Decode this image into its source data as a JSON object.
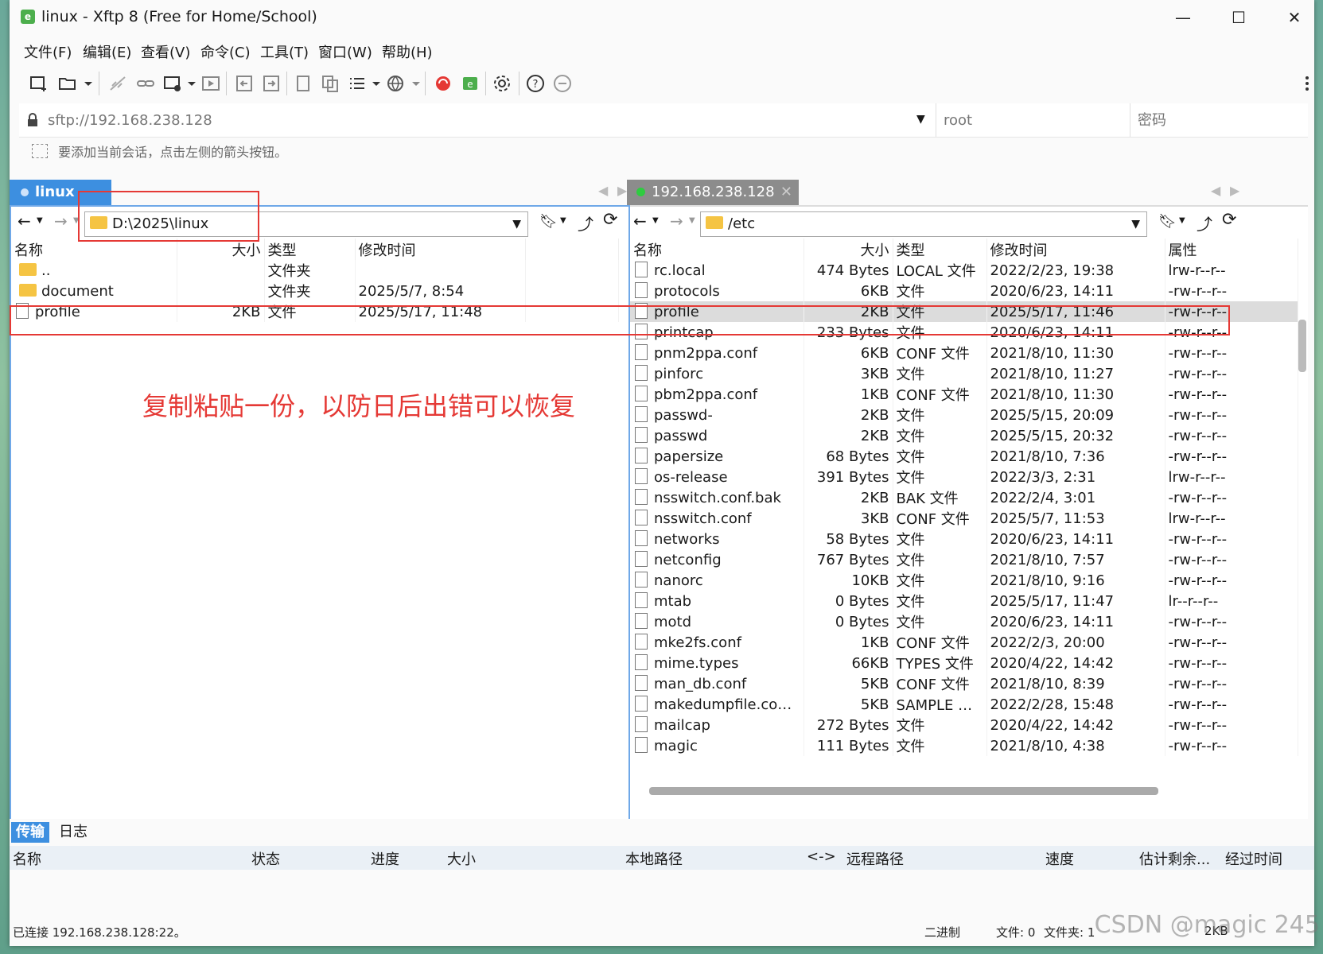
{
  "window": {
    "title": "linux - Xftp 8 (Free for Home/School)"
  },
  "menu": [
    "文件(F)",
    "编辑(E)",
    "查看(V)",
    "命令(C)",
    "工具(T)",
    "窗口(W)",
    "帮助(H)"
  ],
  "address": {
    "url": "sftp://192.168.238.128",
    "user": "root",
    "password_placeholder": "密码"
  },
  "hint": "要添加当前会话，点击左侧的箭头按钮。",
  "left_pane": {
    "tab": "linux",
    "path": "D:\\2025\\linux",
    "columns": [
      "名称",
      "大小",
      "类型",
      "修改时间"
    ],
    "rows": [
      {
        "name": "..",
        "size": "",
        "type": "文件夹",
        "modified": "",
        "kind": "folder"
      },
      {
        "name": "document",
        "size": "",
        "type": "文件夹",
        "modified": "2025/5/7, 8:54",
        "kind": "folder"
      },
      {
        "name": "profile",
        "size": "2KB",
        "type": "文件",
        "modified": "2025/5/17, 11:48",
        "kind": "file"
      }
    ]
  },
  "right_pane": {
    "tab": "192.168.238.128",
    "path": "/etc",
    "columns": [
      "名称",
      "大小",
      "类型",
      "修改时间",
      "属性"
    ],
    "rows": [
      {
        "name": "rc.local",
        "size": "474 Bytes",
        "type": "LOCAL 文件",
        "modified": "2022/2/23, 19:38",
        "attr": "lrw-r--r--"
      },
      {
        "name": "protocols",
        "size": "6KB",
        "type": "文件",
        "modified": "2020/6/23, 14:11",
        "attr": "-rw-r--r--"
      },
      {
        "name": "profile",
        "size": "2KB",
        "type": "文件",
        "modified": "2025/5/17, 11:46",
        "attr": "-rw-r--r--"
      },
      {
        "name": "printcap",
        "size": "233 Bytes",
        "type": "文件",
        "modified": "2020/6/23, 14:11",
        "attr": "-rw-r--r--"
      },
      {
        "name": "pnm2ppa.conf",
        "size": "6KB",
        "type": "CONF 文件",
        "modified": "2021/8/10, 11:30",
        "attr": "-rw-r--r--"
      },
      {
        "name": "pinforc",
        "size": "3KB",
        "type": "文件",
        "modified": "2021/8/10, 11:27",
        "attr": "-rw-r--r--"
      },
      {
        "name": "pbm2ppa.conf",
        "size": "1KB",
        "type": "CONF 文件",
        "modified": "2021/8/10, 11:30",
        "attr": "-rw-r--r--"
      },
      {
        "name": "passwd-",
        "size": "2KB",
        "type": "文件",
        "modified": "2025/5/15, 20:09",
        "attr": "-rw-r--r--"
      },
      {
        "name": "passwd",
        "size": "2KB",
        "type": "文件",
        "modified": "2025/5/15, 20:32",
        "attr": "-rw-r--r--"
      },
      {
        "name": "papersize",
        "size": "68 Bytes",
        "type": "文件",
        "modified": "2021/8/10, 7:36",
        "attr": "-rw-r--r--"
      },
      {
        "name": "os-release",
        "size": "391 Bytes",
        "type": "文件",
        "modified": "2022/3/3, 2:31",
        "attr": "lrw-r--r--"
      },
      {
        "name": "nsswitch.conf.bak",
        "size": "2KB",
        "type": "BAK 文件",
        "modified": "2022/2/4, 3:01",
        "attr": "-rw-r--r--"
      },
      {
        "name": "nsswitch.conf",
        "size": "3KB",
        "type": "CONF 文件",
        "modified": "2025/5/7, 11:53",
        "attr": "lrw-r--r--"
      },
      {
        "name": "networks",
        "size": "58 Bytes",
        "type": "文件",
        "modified": "2020/6/23, 14:11",
        "attr": "-rw-r--r--"
      },
      {
        "name": "netconfig",
        "size": "767 Bytes",
        "type": "文件",
        "modified": "2021/8/10, 7:57",
        "attr": "-rw-r--r--"
      },
      {
        "name": "nanorc",
        "size": "10KB",
        "type": "文件",
        "modified": "2021/8/10, 9:16",
        "attr": "-rw-r--r--"
      },
      {
        "name": "mtab",
        "size": "0 Bytes",
        "type": "文件",
        "modified": "2025/5/17, 11:47",
        "attr": "lr--r--r--"
      },
      {
        "name": "motd",
        "size": "0 Bytes",
        "type": "文件",
        "modified": "2020/6/23, 14:11",
        "attr": "-rw-r--r--"
      },
      {
        "name": "mke2fs.conf",
        "size": "1KB",
        "type": "CONF 文件",
        "modified": "2022/2/3, 20:00",
        "attr": "-rw-r--r--"
      },
      {
        "name": "mime.types",
        "size": "66KB",
        "type": "TYPES 文件",
        "modified": "2020/4/22, 14:42",
        "attr": "-rw-r--r--"
      },
      {
        "name": "man_db.conf",
        "size": "5KB",
        "type": "CONF 文件",
        "modified": "2021/8/10, 8:39",
        "attr": "-rw-r--r--"
      },
      {
        "name": "makedumpfile.conf.s...",
        "size": "5KB",
        "type": "SAMPLE 文...",
        "modified": "2022/2/28, 15:48",
        "attr": "-rw-r--r--"
      },
      {
        "name": "mailcap",
        "size": "272 Bytes",
        "type": "文件",
        "modified": "2020/4/22, 14:42",
        "attr": "-rw-r--r--"
      },
      {
        "name": "magic",
        "size": "111 Bytes",
        "type": "文件",
        "modified": "2021/8/10, 4:38",
        "attr": "-rw-r--r--"
      }
    ]
  },
  "annotation": "复制粘贴一份，以防日后出错可以恢复",
  "bottom_tabs": [
    "传输",
    "日志"
  ],
  "transfer_columns": [
    "名称",
    "状态",
    "进度",
    "大小",
    "本地路径",
    "<->",
    "远程路径",
    "速度",
    "估计剩余...",
    "经过时间"
  ],
  "status": {
    "connected": "已连接 192.168.238.128:22。",
    "mode": "二进制",
    "files": "文件: 0",
    "folders": "文件夹: 1",
    "size": "2KB"
  },
  "watermark": "CSDN @magic 245",
  "colors": {
    "tab_blue": "#3d8fe0",
    "annotation_red": "#e53935",
    "online_green": "#2ecc40"
  }
}
